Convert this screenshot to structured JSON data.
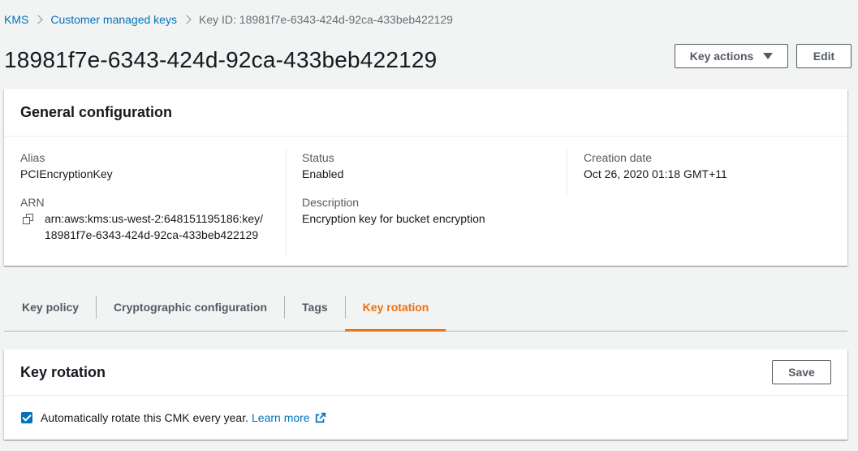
{
  "breadcrumb": {
    "items": [
      "KMS",
      "Customer managed keys"
    ],
    "current": "Key ID: 18981f7e-6343-424d-92ca-433beb422129"
  },
  "page_title": "18981f7e-6343-424d-92ca-433beb422129",
  "actions": {
    "key_actions_label": "Key actions",
    "edit_label": "Edit"
  },
  "general": {
    "title": "General configuration",
    "alias_label": "Alias",
    "alias_value": "PCIEncryptionKey",
    "arn_label": "ARN",
    "arn_line1": "arn:aws:kms:us-west-2:648151195186:key/",
    "arn_line2": "18981f7e-6343-424d-92ca-433beb422129",
    "status_label": "Status",
    "status_value": "Enabled",
    "description_label": "Description",
    "description_value": "Encryption key for bucket encryption",
    "creation_label": "Creation date",
    "creation_value": "Oct 26, 2020 01:18 GMT+11"
  },
  "tabs": [
    {
      "label": "Key policy",
      "active": false
    },
    {
      "label": "Cryptographic configuration",
      "active": false
    },
    {
      "label": "Tags",
      "active": false
    },
    {
      "label": "Key rotation",
      "active": true
    }
  ],
  "rotation": {
    "title": "Key rotation",
    "save_label": "Save",
    "checkbox_checked": true,
    "checkbox_text": "Automatically rotate this CMK every year.",
    "learn_more": "Learn more"
  },
  "colors": {
    "link": "#0073bb",
    "active_tab": "#ec7211",
    "background": "#f2f3f3"
  },
  "icons": [
    "chevron-right-icon",
    "caret-down-icon",
    "copy-icon",
    "checkbox-checked-icon",
    "external-link-icon"
  ]
}
